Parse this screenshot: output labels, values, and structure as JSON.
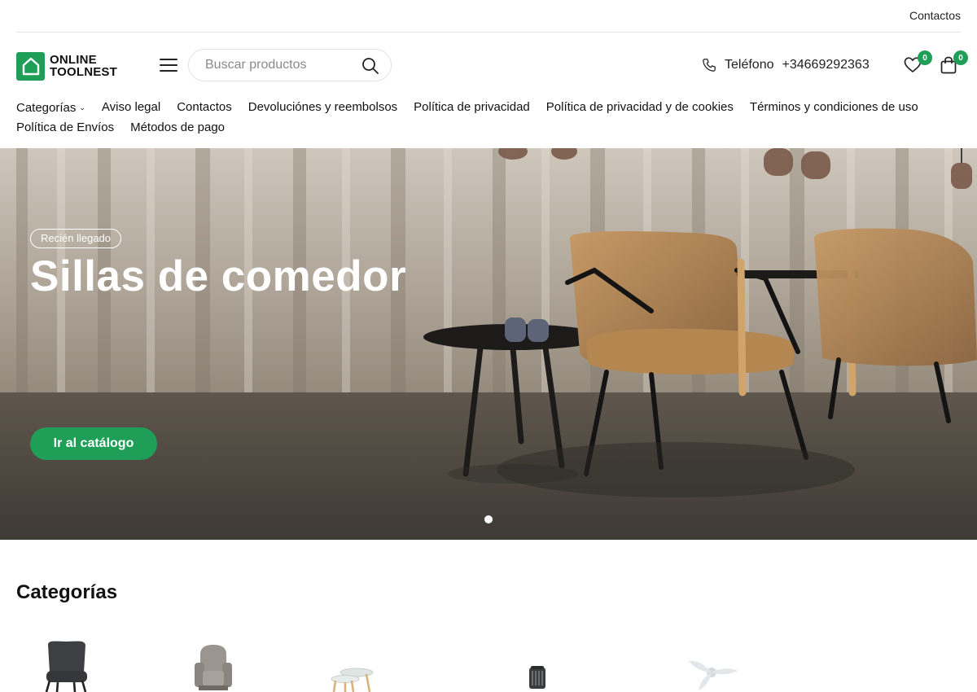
{
  "topbar": {
    "contacts_label": "Contactos"
  },
  "logo": {
    "line1": "ONLINE",
    "line2": "TOOLNEST"
  },
  "search": {
    "placeholder": "Buscar productos"
  },
  "phone": {
    "label": "Teléfono",
    "number": "+34669292363"
  },
  "wishlist": {
    "count": "0"
  },
  "cart": {
    "count": "0"
  },
  "nav": {
    "items": [
      "Categorías",
      "Aviso legal",
      "Contactos",
      "Devoluciónes y reembolsos",
      "Política de privacidad",
      "Política de privacidad y de cookies",
      "Términos y condiciones de uso",
      "Política de Envíos",
      "Métodos de pago"
    ]
  },
  "hero": {
    "badge": "Recién llegado",
    "title": "Sillas de comedor",
    "cta": "Ir al catálogo"
  },
  "categories": {
    "title": "Categorías"
  },
  "colors": {
    "accent": "#1f9e57",
    "text": "#111111"
  },
  "icons": [
    "menu-icon",
    "search-icon",
    "phone-icon",
    "heart-icon",
    "shopping-bag-icon"
  ]
}
